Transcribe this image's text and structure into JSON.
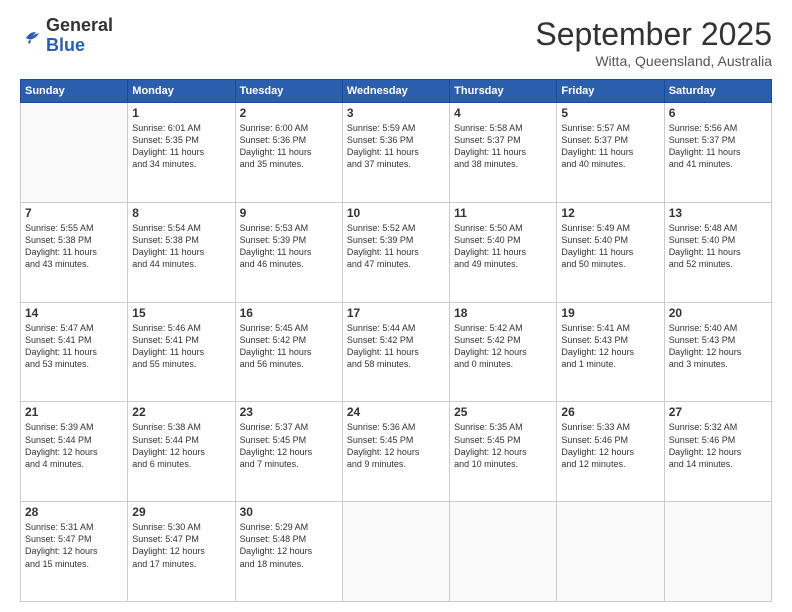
{
  "header": {
    "logo_general": "General",
    "logo_blue": "Blue",
    "month": "September 2025",
    "location": "Witta, Queensland, Australia"
  },
  "days_of_week": [
    "Sunday",
    "Monday",
    "Tuesday",
    "Wednesday",
    "Thursday",
    "Friday",
    "Saturday"
  ],
  "weeks": [
    [
      {
        "day": "",
        "info": ""
      },
      {
        "day": "1",
        "info": "Sunrise: 6:01 AM\nSunset: 5:35 PM\nDaylight: 11 hours\nand 34 minutes."
      },
      {
        "day": "2",
        "info": "Sunrise: 6:00 AM\nSunset: 5:36 PM\nDaylight: 11 hours\nand 35 minutes."
      },
      {
        "day": "3",
        "info": "Sunrise: 5:59 AM\nSunset: 5:36 PM\nDaylight: 11 hours\nand 37 minutes."
      },
      {
        "day": "4",
        "info": "Sunrise: 5:58 AM\nSunset: 5:37 PM\nDaylight: 11 hours\nand 38 minutes."
      },
      {
        "day": "5",
        "info": "Sunrise: 5:57 AM\nSunset: 5:37 PM\nDaylight: 11 hours\nand 40 minutes."
      },
      {
        "day": "6",
        "info": "Sunrise: 5:56 AM\nSunset: 5:37 PM\nDaylight: 11 hours\nand 41 minutes."
      }
    ],
    [
      {
        "day": "7",
        "info": "Sunrise: 5:55 AM\nSunset: 5:38 PM\nDaylight: 11 hours\nand 43 minutes."
      },
      {
        "day": "8",
        "info": "Sunrise: 5:54 AM\nSunset: 5:38 PM\nDaylight: 11 hours\nand 44 minutes."
      },
      {
        "day": "9",
        "info": "Sunrise: 5:53 AM\nSunset: 5:39 PM\nDaylight: 11 hours\nand 46 minutes."
      },
      {
        "day": "10",
        "info": "Sunrise: 5:52 AM\nSunset: 5:39 PM\nDaylight: 11 hours\nand 47 minutes."
      },
      {
        "day": "11",
        "info": "Sunrise: 5:50 AM\nSunset: 5:40 PM\nDaylight: 11 hours\nand 49 minutes."
      },
      {
        "day": "12",
        "info": "Sunrise: 5:49 AM\nSunset: 5:40 PM\nDaylight: 11 hours\nand 50 minutes."
      },
      {
        "day": "13",
        "info": "Sunrise: 5:48 AM\nSunset: 5:40 PM\nDaylight: 11 hours\nand 52 minutes."
      }
    ],
    [
      {
        "day": "14",
        "info": "Sunrise: 5:47 AM\nSunset: 5:41 PM\nDaylight: 11 hours\nand 53 minutes."
      },
      {
        "day": "15",
        "info": "Sunrise: 5:46 AM\nSunset: 5:41 PM\nDaylight: 11 hours\nand 55 minutes."
      },
      {
        "day": "16",
        "info": "Sunrise: 5:45 AM\nSunset: 5:42 PM\nDaylight: 11 hours\nand 56 minutes."
      },
      {
        "day": "17",
        "info": "Sunrise: 5:44 AM\nSunset: 5:42 PM\nDaylight: 11 hours\nand 58 minutes."
      },
      {
        "day": "18",
        "info": "Sunrise: 5:42 AM\nSunset: 5:42 PM\nDaylight: 12 hours\nand 0 minutes."
      },
      {
        "day": "19",
        "info": "Sunrise: 5:41 AM\nSunset: 5:43 PM\nDaylight: 12 hours\nand 1 minute."
      },
      {
        "day": "20",
        "info": "Sunrise: 5:40 AM\nSunset: 5:43 PM\nDaylight: 12 hours\nand 3 minutes."
      }
    ],
    [
      {
        "day": "21",
        "info": "Sunrise: 5:39 AM\nSunset: 5:44 PM\nDaylight: 12 hours\nand 4 minutes."
      },
      {
        "day": "22",
        "info": "Sunrise: 5:38 AM\nSunset: 5:44 PM\nDaylight: 12 hours\nand 6 minutes."
      },
      {
        "day": "23",
        "info": "Sunrise: 5:37 AM\nSunset: 5:45 PM\nDaylight: 12 hours\nand 7 minutes."
      },
      {
        "day": "24",
        "info": "Sunrise: 5:36 AM\nSunset: 5:45 PM\nDaylight: 12 hours\nand 9 minutes."
      },
      {
        "day": "25",
        "info": "Sunrise: 5:35 AM\nSunset: 5:45 PM\nDaylight: 12 hours\nand 10 minutes."
      },
      {
        "day": "26",
        "info": "Sunrise: 5:33 AM\nSunset: 5:46 PM\nDaylight: 12 hours\nand 12 minutes."
      },
      {
        "day": "27",
        "info": "Sunrise: 5:32 AM\nSunset: 5:46 PM\nDaylight: 12 hours\nand 14 minutes."
      }
    ],
    [
      {
        "day": "28",
        "info": "Sunrise: 5:31 AM\nSunset: 5:47 PM\nDaylight: 12 hours\nand 15 minutes."
      },
      {
        "day": "29",
        "info": "Sunrise: 5:30 AM\nSunset: 5:47 PM\nDaylight: 12 hours\nand 17 minutes."
      },
      {
        "day": "30",
        "info": "Sunrise: 5:29 AM\nSunset: 5:48 PM\nDaylight: 12 hours\nand 18 minutes."
      },
      {
        "day": "",
        "info": ""
      },
      {
        "day": "",
        "info": ""
      },
      {
        "day": "",
        "info": ""
      },
      {
        "day": "",
        "info": ""
      }
    ]
  ]
}
